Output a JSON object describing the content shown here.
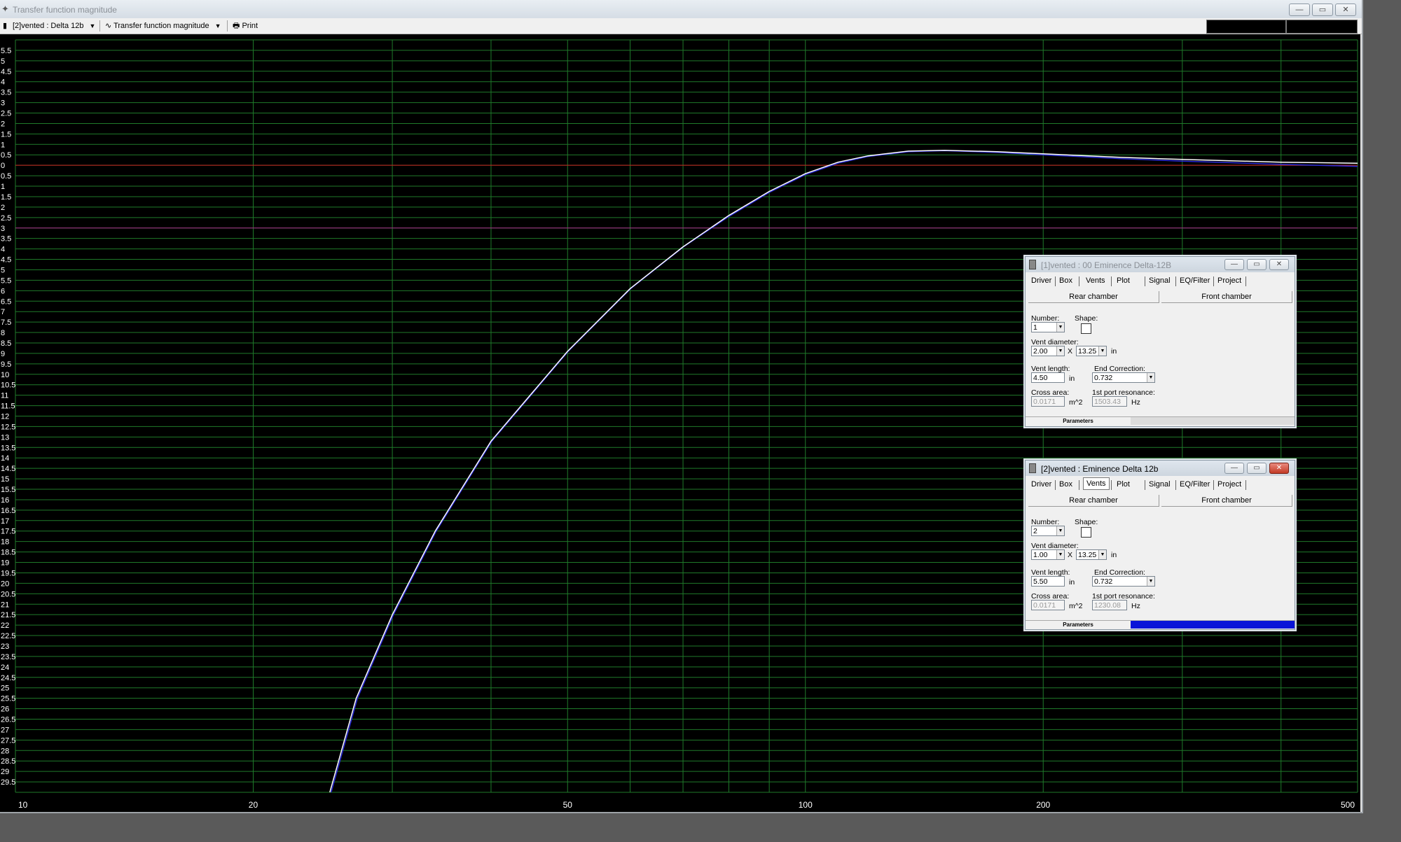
{
  "window": {
    "title": "Transfer function magnitude",
    "btn_min": "—",
    "btn_max": "▭",
    "btn_close": "✕"
  },
  "toolbar": {
    "project_select": "[2]vented : Delta 12b",
    "plot_select": "Transfer function magnitude",
    "print_label": "Print",
    "plot_icon": "wave-icon",
    "print_icon": "printer-icon"
  },
  "chart_data": {
    "type": "line",
    "x_scale": "log",
    "xlim": [
      10,
      500
    ],
    "x_ticks": [
      10,
      20,
      50,
      100,
      200,
      500
    ],
    "y_tick_labels": [
      "5.5",
      "5",
      "4.5",
      "4",
      "3.5",
      "3",
      "2.5",
      "2",
      "1.5",
      "1",
      "0.5",
      "0",
      "0.5",
      "1",
      "1.5",
      "2",
      "2.5",
      "3",
      "3.5",
      "4",
      "4.5",
      "5",
      "5.5",
      "6",
      "6.5",
      "7",
      "7.5",
      "8",
      "8.5",
      "9",
      "9.5",
      "10",
      "10.5",
      "11",
      "11.5",
      "12",
      "12.5",
      "13",
      "13.5",
      "14",
      "14.5",
      "15",
      "15.5",
      "16",
      "16.5",
      "17",
      "17.5",
      "18",
      "18.5",
      "19",
      "19.5",
      "20",
      "20.5",
      "21",
      "21.5",
      "22",
      "22.5",
      "23",
      "23.5",
      "24",
      "24.5",
      "25",
      "25.5",
      "26",
      "26.5",
      "27",
      "27.5",
      "28",
      "28.5",
      "29",
      "29.5"
    ],
    "ylim": [
      -30,
      6
    ],
    "grid": true,
    "reference_lines": [
      {
        "y": 0,
        "color": "#cc2020"
      },
      {
        "y": -3,
        "color": "#aa2a8a"
      }
    ],
    "series": [
      {
        "color": "#ffffff",
        "points": [
          [
            25.0,
            -30
          ],
          [
            27,
            -25.5
          ],
          [
            30,
            -21.5
          ],
          [
            34,
            -17.5
          ],
          [
            40,
            -13.2
          ],
          [
            50,
            -8.9
          ],
          [
            60,
            -5.9
          ],
          [
            70,
            -3.9
          ],
          [
            80,
            -2.4
          ],
          [
            90,
            -1.25
          ],
          [
            100,
            -0.4
          ],
          [
            110,
            0.15
          ],
          [
            120,
            0.45
          ],
          [
            135,
            0.68
          ],
          [
            150,
            0.72
          ],
          [
            175,
            0.65
          ],
          [
            200,
            0.55
          ],
          [
            250,
            0.38
          ],
          [
            300,
            0.28
          ],
          [
            400,
            0.15
          ],
          [
            500,
            0.1
          ]
        ]
      },
      {
        "color": "#2a2ad8",
        "points": [
          [
            25.1,
            -30
          ],
          [
            27.1,
            -25.5
          ],
          [
            30.1,
            -21.5
          ],
          [
            34.1,
            -17.5
          ],
          [
            40.1,
            -13.2
          ],
          [
            50.1,
            -8.9
          ],
          [
            60.1,
            -5.9
          ],
          [
            70.1,
            -3.9
          ],
          [
            80,
            -2.45
          ],
          [
            90,
            -1.3
          ],
          [
            100,
            -0.45
          ],
          [
            110,
            0.1
          ],
          [
            120,
            0.42
          ],
          [
            135,
            0.65
          ],
          [
            150,
            0.7
          ],
          [
            175,
            0.62
          ],
          [
            200,
            0.5
          ],
          [
            250,
            0.32
          ],
          [
            300,
            0.2
          ],
          [
            400,
            0.05
          ],
          [
            500,
            -0.05
          ]
        ]
      }
    ]
  },
  "dialog1": {
    "title": "[1]vented : 00 Eminence Delta-12B",
    "tabs": [
      "Driver",
      "Box",
      "Vents",
      "Plot",
      "Signal",
      "EQ/Filter",
      "Project"
    ],
    "active_tab": "Vents",
    "rear_chamber": "Rear chamber",
    "front_chamber": "Front chamber",
    "number_label": "Number:",
    "number_value": "1",
    "shape_label": "Shape:",
    "vent_diameter_label": "Vent diameter:",
    "vent_diameter_value": "2.00",
    "x_symbol": "X",
    "vent_diameter2_value": "13.25",
    "unit_in": "in",
    "vent_length_label": "Vent length:",
    "vent_length_value": "4.50",
    "end_correction_label": "End Correction:",
    "end_correction_value": "0.732",
    "cross_area_label": "Cross area:",
    "cross_area_value": "0.0171",
    "cross_area_unit": "m^2",
    "port_res_label": "1st port resonance:",
    "port_res_value": "1503.43",
    "port_res_unit": "Hz",
    "status_label": "Parameters"
  },
  "dialog2": {
    "title": "[2]vented : Eminence Delta 12b",
    "tabs": [
      "Driver",
      "Box",
      "Vents",
      "Plot",
      "Signal",
      "EQ/Filter",
      "Project"
    ],
    "active_tab": "Vents",
    "rear_chamber": "Rear chamber",
    "front_chamber": "Front chamber",
    "number_label": "Number:",
    "number_value": "2",
    "shape_label": "Shape:",
    "vent_diameter_label": "Vent diameter:",
    "vent_diameter_value": "1.00",
    "x_symbol": "X",
    "vent_diameter2_value": "13.25",
    "unit_in": "in",
    "vent_length_label": "Vent length:",
    "vent_length_value": "5.50",
    "end_correction_label": "End Correction:",
    "end_correction_value": "0.732",
    "cross_area_label": "Cross area:",
    "cross_area_value": "0.0171",
    "cross_area_unit": "m^2",
    "port_res_label": "1st port resonance:",
    "port_res_value": "1230.08",
    "port_res_unit": "Hz",
    "status_label": "Parameters",
    "status_color": "#0a14d8"
  }
}
